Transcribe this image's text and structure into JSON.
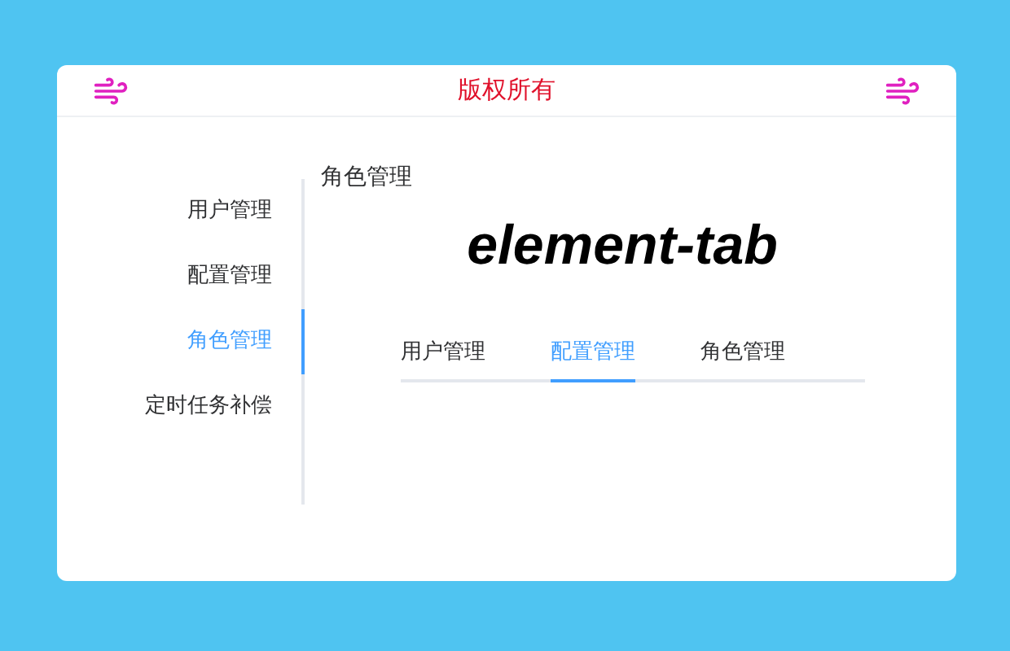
{
  "header": {
    "title": "版权所有"
  },
  "sidebar": {
    "items": [
      {
        "label": "用户管理",
        "selected": false
      },
      {
        "label": "配置管理",
        "selected": false
      },
      {
        "label": "角色管理",
        "selected": true
      },
      {
        "label": "定时任务补偿",
        "selected": false
      }
    ]
  },
  "content": {
    "title": "角色管理",
    "heading": "element-tab",
    "tabs": [
      {
        "label": "用户管理",
        "selected": false
      },
      {
        "label": "配置管理",
        "selected": true
      },
      {
        "label": "角色管理",
        "selected": false
      }
    ]
  }
}
